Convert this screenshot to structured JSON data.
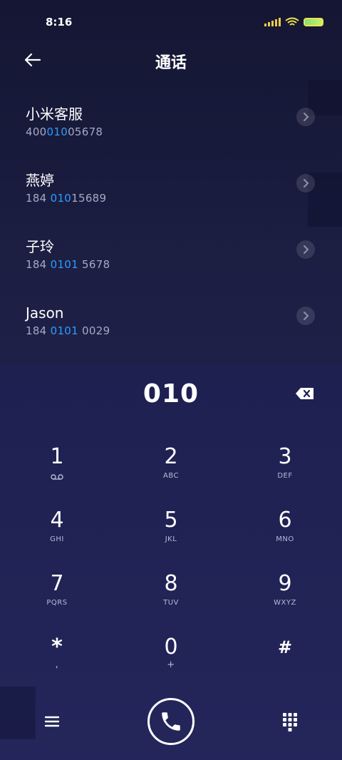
{
  "status": {
    "time": "8:16",
    "icons": [
      "signal-icon",
      "wifi-icon",
      "battery-icon"
    ]
  },
  "header": {
    "title": "通话",
    "back_icon": "arrow-left-icon"
  },
  "contacts": [
    {
      "name": "小米客服",
      "number_before": "400",
      "number_match": "010",
      "number_after": "05678"
    },
    {
      "name": "燕婷",
      "number_before": "184 ",
      "number_match": "010",
      "number_after": "15689"
    },
    {
      "name": "子玲",
      "number_before": "184 ",
      "number_match": "0101",
      "number_after": " 5678"
    },
    {
      "name": "Jason",
      "number_before": "184 ",
      "number_match": "0101",
      "number_after": " 0029"
    }
  ],
  "dialer": {
    "input": "010",
    "keys": [
      {
        "digit": "1",
        "letters": ""
      },
      {
        "digit": "2",
        "letters": "ABC"
      },
      {
        "digit": "3",
        "letters": "DEF"
      },
      {
        "digit": "4",
        "letters": "GHI"
      },
      {
        "digit": "5",
        "letters": "JKL"
      },
      {
        "digit": "6",
        "letters": "MNO"
      },
      {
        "digit": "7",
        "letters": "PQRS"
      },
      {
        "digit": "8",
        "letters": "TUV"
      },
      {
        "digit": "9",
        "letters": "WXYZ"
      },
      {
        "digit": "*",
        "letters": ","
      },
      {
        "digit": "0",
        "letters": "+"
      },
      {
        "digit": "#",
        "letters": ""
      }
    ]
  },
  "colors": {
    "accent": "#2e9bff",
    "background": "#1d1f45",
    "text_secondary": "#a6a9c4"
  }
}
